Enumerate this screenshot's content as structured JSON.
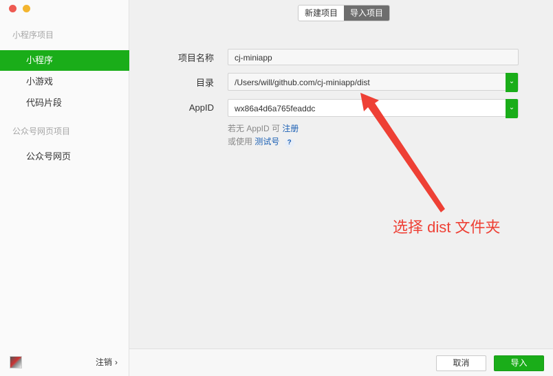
{
  "sidebar": {
    "section1_title": "小程序项目",
    "items": [
      {
        "label": "小程序",
        "active": true
      },
      {
        "label": "小游戏"
      },
      {
        "label": "代码片段"
      }
    ],
    "section2_title": "公众号网页项目",
    "items2": [
      {
        "label": "公众号网页"
      }
    ],
    "logout_label": "注销"
  },
  "tabs": {
    "new_project": "新建项目",
    "import_project": "导入项目"
  },
  "form": {
    "name_label": "项目名称",
    "name_value": "cj-miniapp",
    "dir_label": "目录",
    "dir_value": "/Users/will/github.com/cj-miniapp/dist",
    "appid_label": "AppID",
    "appid_value": "wx86a4d6a765feaddc",
    "hint1_prefix": "若无 AppID 可",
    "hint1_link": "注册",
    "hint2_prefix": "或使用",
    "hint2_link": "测试号",
    "hint2_help": "?"
  },
  "annotation": "选择 dist 文件夹",
  "footer": {
    "cancel_label": "取消",
    "import_label": "导入"
  },
  "colors": {
    "accent": "#1aad19",
    "annotation": "#ee4035",
    "link": "#1a5fb4"
  }
}
